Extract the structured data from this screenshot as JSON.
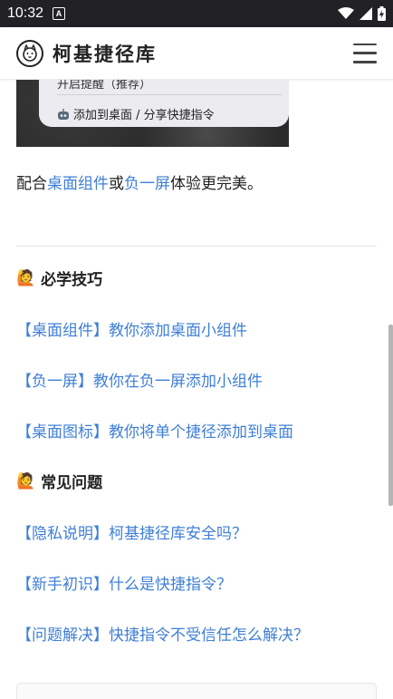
{
  "status": {
    "time": "10:32",
    "a_badge": "A"
  },
  "header": {
    "title": "柯基捷径库",
    "logo_icon": "corgi-logo-icon",
    "menu_icon": "hamburger-menu-icon"
  },
  "screenshot_card": {
    "cut_text": "开启提醒（推荐）",
    "row_icon": "robot-icon",
    "row_label": "添加到桌面 / 分享快捷指令"
  },
  "intro": {
    "prefix": "配合",
    "link1": "桌面组件",
    "mid": "或",
    "link2": "负一屏",
    "suffix": "体验更完美。"
  },
  "sections": [
    {
      "title": "必学技巧",
      "icon": "person-raising-hand-icon",
      "links": [
        "【桌面组件】教你添加桌面小组件",
        "【负一屏】教你在负一屏添加小组件",
        "【桌面图标】教你将单个捷径添加到桌面"
      ]
    },
    {
      "title": "常见问题",
      "icon": "person-raising-hand-icon",
      "links": [
        "【隐私说明】柯基捷径库安全吗？",
        "【新手初识】什么是快捷指令？",
        "【问题解决】快捷指令不受信任怎么解决？"
      ]
    }
  ],
  "colors": {
    "link": "#3f7fd6",
    "status_bar": "#212126"
  }
}
